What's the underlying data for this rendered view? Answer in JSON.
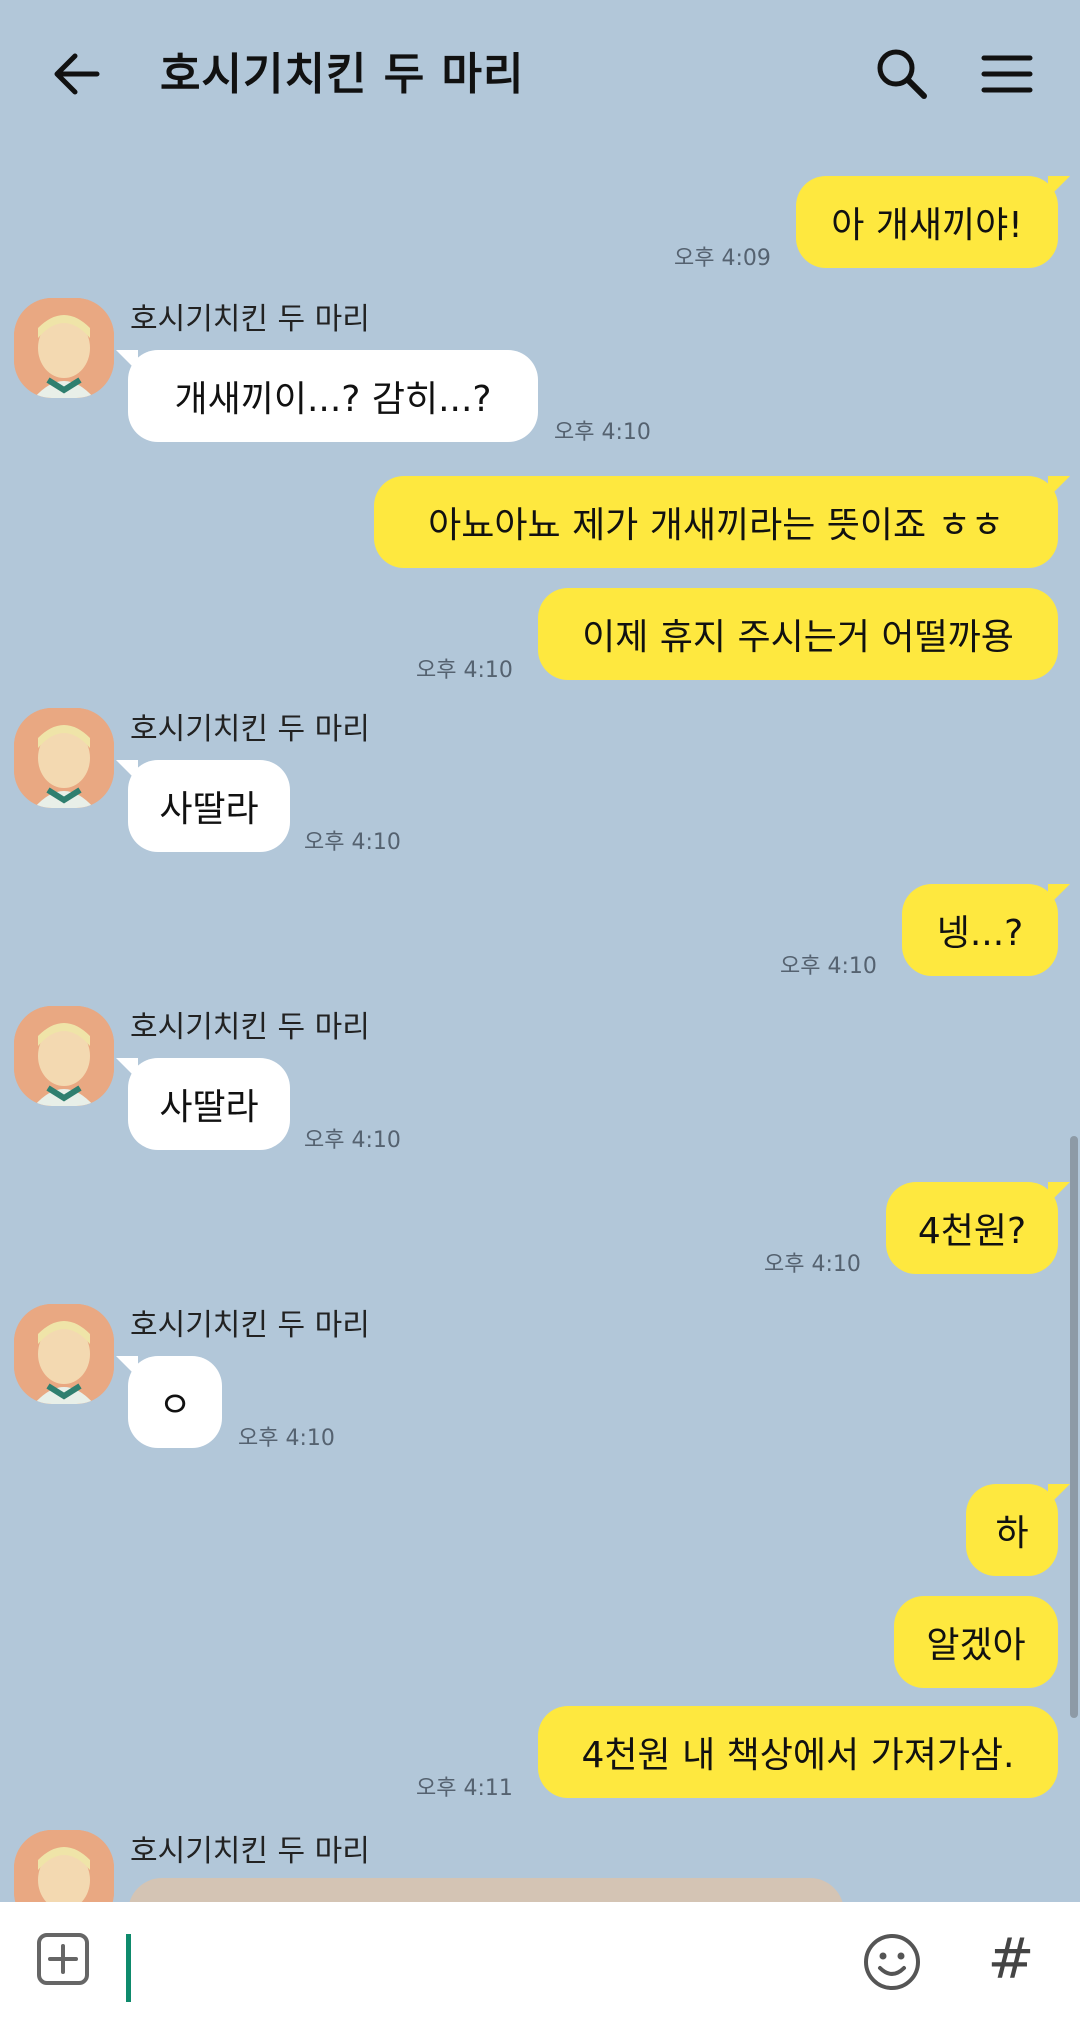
{
  "header": {
    "title": "호시기치킨 두 마리",
    "back_icon": "arrow-left-icon",
    "search_icon": "search-icon",
    "menu_icon": "hamburger-menu-icon"
  },
  "messages": [
    {
      "from": "me",
      "text": "아 개새끼야!",
      "time": "오후 4:09"
    },
    {
      "from": "them",
      "sender": "호시기치킨 두 마리",
      "text": "개새끼이...? 감히...?",
      "time": "오후 4:10"
    },
    {
      "from": "me",
      "text": "아뇨아뇨 제가 개새끼라는 뜻이죠 ㅎㅎ",
      "time": ""
    },
    {
      "from": "me",
      "text": "이제 휴지 주시는거 어떨까용",
      "time": "오후 4:10"
    },
    {
      "from": "them",
      "sender": "호시기치킨 두 마리",
      "text": "사딸라",
      "time": "오후 4:10"
    },
    {
      "from": "me",
      "text": "넹...?",
      "time": "오후 4:10"
    },
    {
      "from": "them",
      "sender": "호시기치킨 두 마리",
      "text": "사딸라",
      "time": "오후 4:10"
    },
    {
      "from": "me",
      "text": "4천원?",
      "time": "오후 4:10"
    },
    {
      "from": "them",
      "sender": "호시기치킨 두 마리",
      "text": "ㅇ",
      "time": "오후 4:10"
    },
    {
      "from": "me",
      "text": "하",
      "time": ""
    },
    {
      "from": "me",
      "text": "알겠아",
      "time": ""
    },
    {
      "from": "me",
      "text": "4천원 내 책상에서 가져가삼.",
      "time": "오후 4:11"
    },
    {
      "from": "them",
      "sender": "호시기치킨 두 마리",
      "text": "",
      "time": ""
    }
  ],
  "input_bar": {
    "add_icon": "plus-square-icon",
    "emoji_icon": "emoji-smile-icon",
    "hash_label": "#"
  },
  "colors": {
    "background": "#b2c7d9",
    "my_bubble": "#fee83f",
    "their_bubble": "#ffffff",
    "caret": "#0e8a6c"
  }
}
